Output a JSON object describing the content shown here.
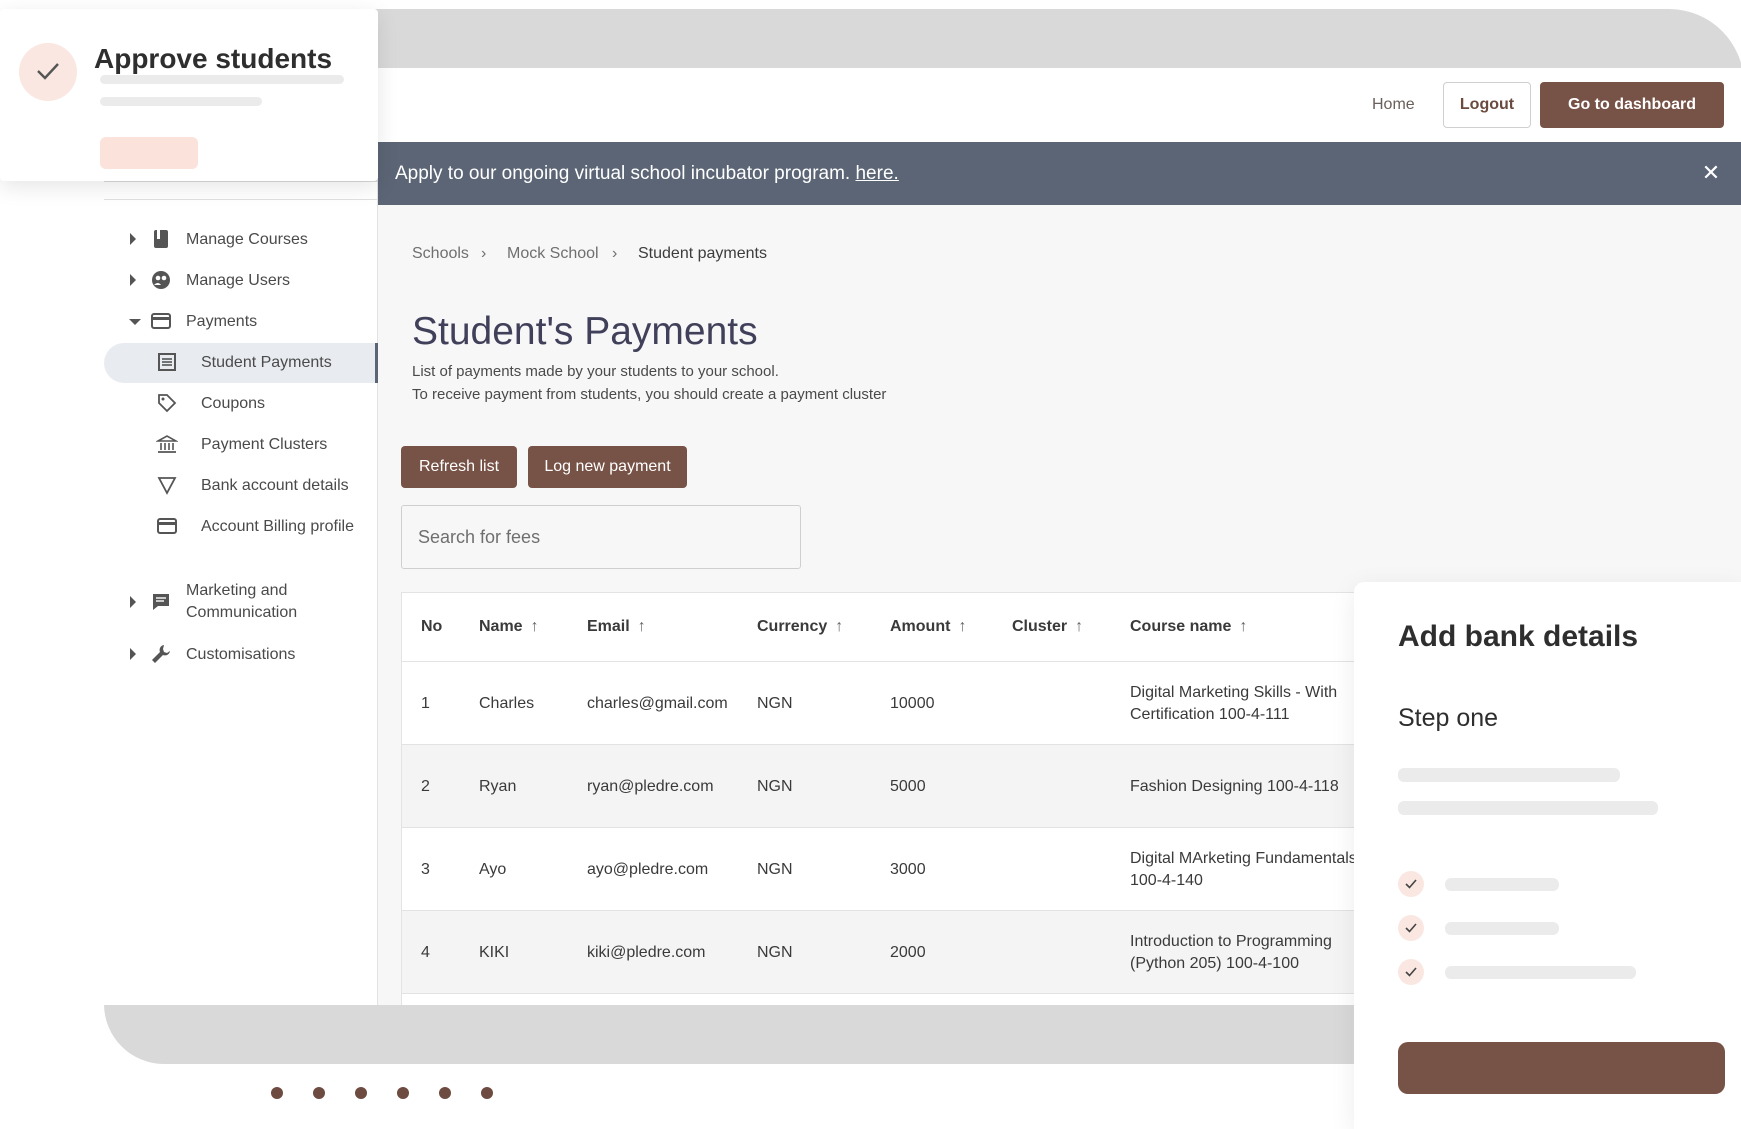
{
  "approve_card": {
    "title": "Approve students"
  },
  "header": {
    "home": "Home",
    "logout": "Logout",
    "dashboard": "Go to dashboard"
  },
  "banner": {
    "text": "Apply to our ongoing virtual school incubator program.",
    "link": "here."
  },
  "sidebar": {
    "items": [
      {
        "label": "Manage Courses",
        "icon": "book-icon"
      },
      {
        "label": "Manage Users",
        "icon": "users-icon"
      },
      {
        "label": "Payments",
        "icon": "card-icon"
      },
      {
        "label": "Student Payments",
        "icon": "list-icon"
      },
      {
        "label": "Coupons",
        "icon": "tag-icon"
      },
      {
        "label": "Payment Clusters",
        "icon": "bank-icon"
      },
      {
        "label": "Bank account details",
        "icon": "triangle-icon"
      },
      {
        "label": "Account Billing profile",
        "icon": "card-icon"
      },
      {
        "label": "Marketing and Communication",
        "icon": "chat-icon"
      },
      {
        "label": "Customisations",
        "icon": "wrench-icon"
      }
    ]
  },
  "breadcrumb": [
    "Schools",
    "Mock School",
    "Student payments"
  ],
  "page": {
    "title": "Student's Payments",
    "desc1": "List of payments made by your students to your school.",
    "desc2": "To receive payment from students, you should create a payment cluster",
    "refresh": "Refresh list",
    "log_new": "Log new payment",
    "search_placeholder": "Search for fees"
  },
  "table": {
    "headers": [
      "No",
      "Name",
      "Email",
      "Currency",
      "Amount",
      "Cluster",
      "Course name"
    ],
    "rows": [
      {
        "no": "1",
        "name": "Charles",
        "email": "charles@gmail.com",
        "currency": "NGN",
        "amount": "10000",
        "cluster": "",
        "course": "Digital Marketing Skills - With Certification 100-4-111"
      },
      {
        "no": "2",
        "name": "Ryan",
        "email": "ryan@pledre.com",
        "currency": "NGN",
        "amount": "5000",
        "cluster": "",
        "course": "Fashion Designing 100-4-118"
      },
      {
        "no": "3",
        "name": "Ayo",
        "email": "ayo@pledre.com",
        "currency": "NGN",
        "amount": "3000",
        "cluster": "",
        "course": "Digital MArketing Fundamentals 100-4-140"
      },
      {
        "no": "4",
        "name": "KIKI",
        "email": "kiki@pledre.com",
        "currency": "NGN",
        "amount": "2000",
        "cluster": "",
        "course": "Introduction to Programming (Python 205) 100-4-100"
      }
    ]
  },
  "bank_card": {
    "title": "Add bank details",
    "step": "Step one"
  },
  "colors": {
    "brand": "#775246",
    "banner": "#5b6575",
    "title": "#41405a"
  }
}
